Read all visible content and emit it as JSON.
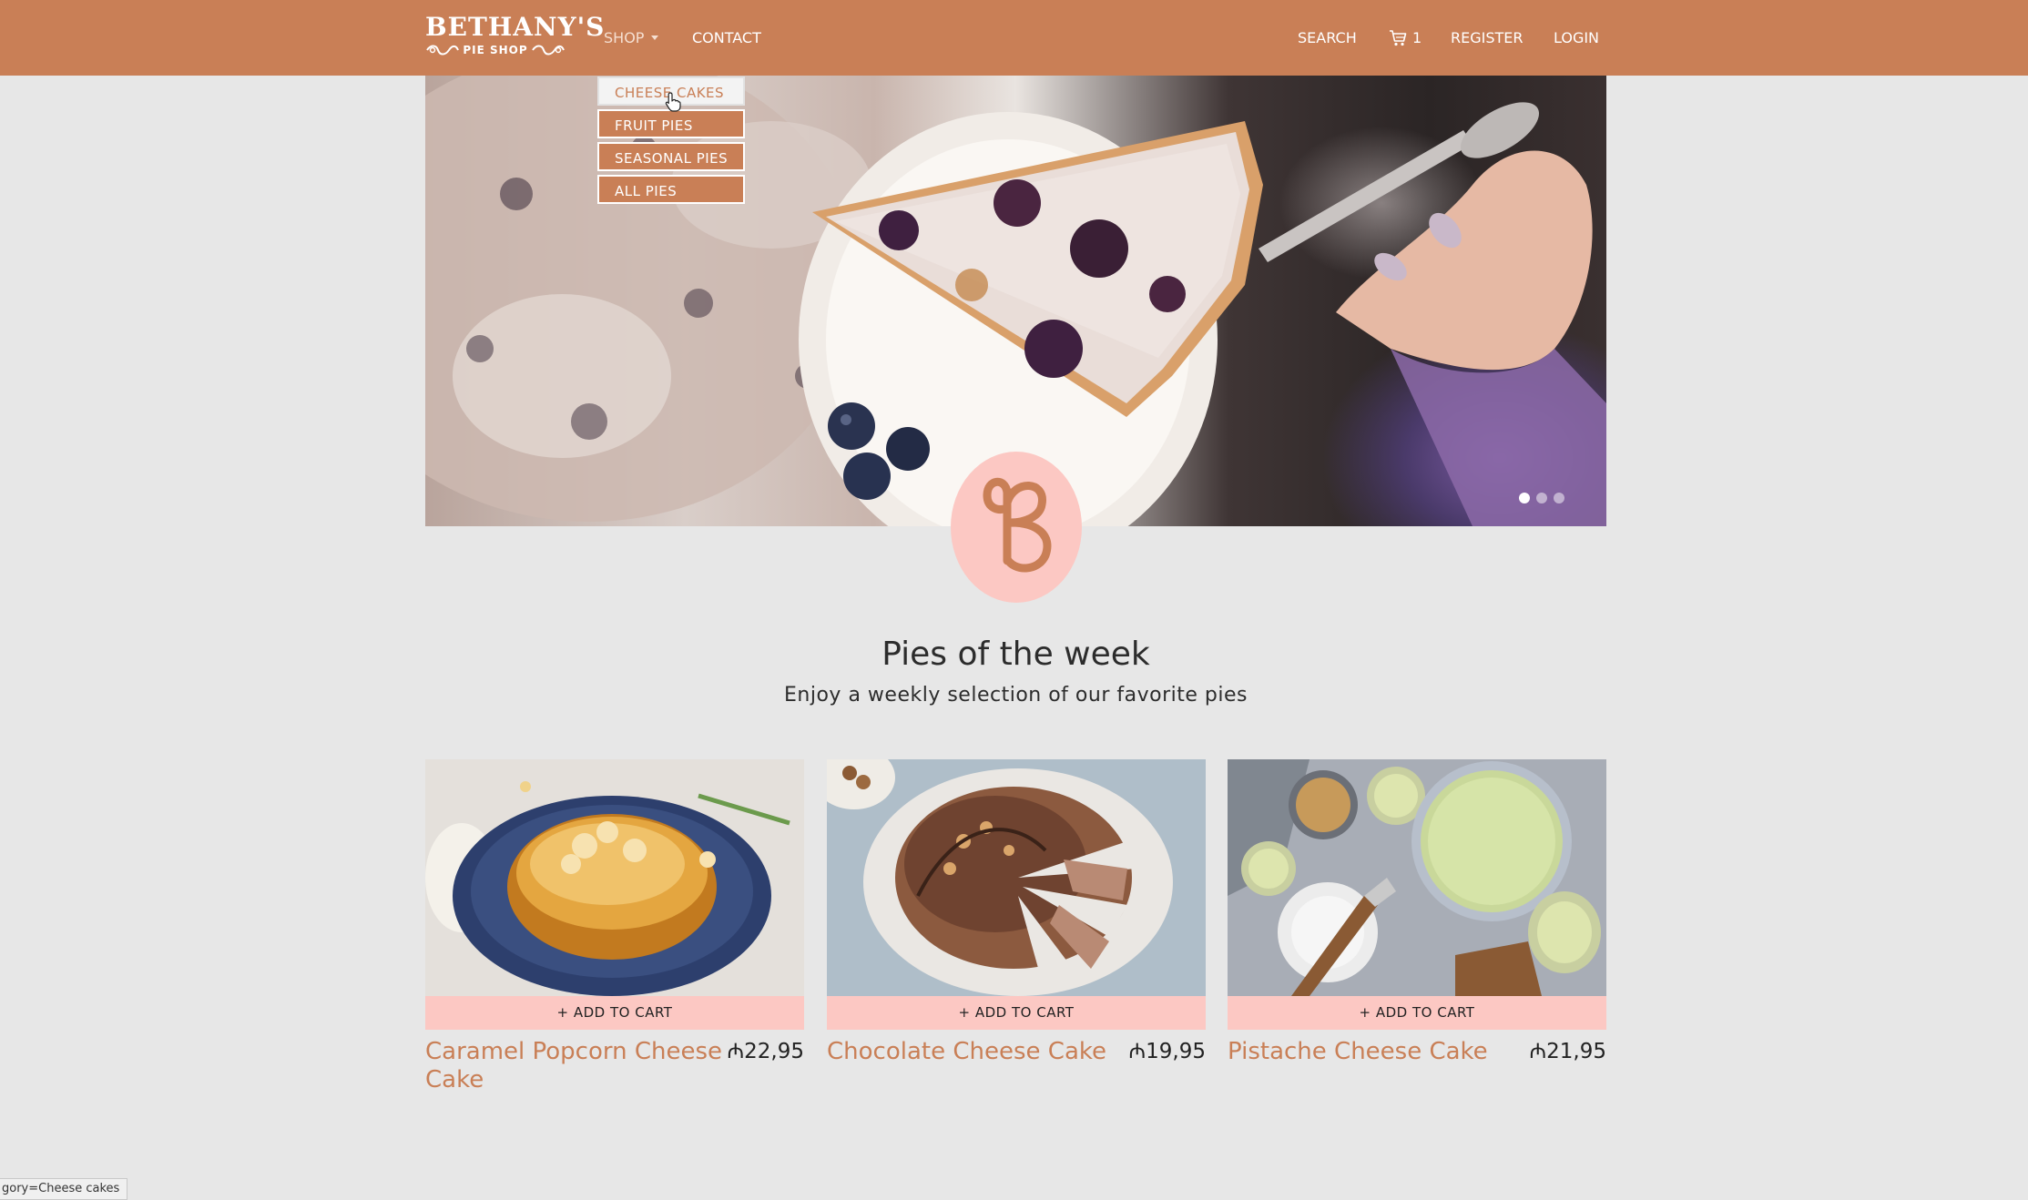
{
  "brand": {
    "name": "BETHANY'S",
    "subtitle": "PIE SHOP"
  },
  "nav": {
    "shop": "SHOP",
    "contact": "CONTACT",
    "search": "SEARCH",
    "cart_count": "1",
    "register": "REGISTER",
    "login": "LOGIN"
  },
  "dropdown": {
    "items": [
      "CHEESE CAKES",
      "FRUIT PIES",
      "SEASONAL PIES",
      "ALL PIES"
    ],
    "hovered": "CHEESE CAKES"
  },
  "carousel": {
    "slides": 3,
    "active_slide": 1
  },
  "section": {
    "title": "Pies of the week",
    "subtitle": "Enjoy a weekly selection of our favorite pies"
  },
  "products": [
    {
      "name": "Caramel Popcorn Cheese Cake",
      "price": "₼22,95",
      "button": "+ ADD TO CART"
    },
    {
      "name": "Chocolate Cheese Cake",
      "price": "₼19,95",
      "button": "+ ADD TO CART"
    },
    {
      "name": "Pistache Cheese Cake",
      "price": "₼21,95",
      "button": "+ ADD TO CART"
    }
  ],
  "status_bar": {
    "text": "gory=Cheese cakes"
  },
  "colors": {
    "navbar": "#c97f56",
    "accent": "#c97f56",
    "button_pink": "#fcc8c3",
    "page_bg": "#e7e7e7"
  },
  "icons": [
    "cart-icon",
    "pointer-cursor-icon",
    "bethanys-logo-icon"
  ]
}
